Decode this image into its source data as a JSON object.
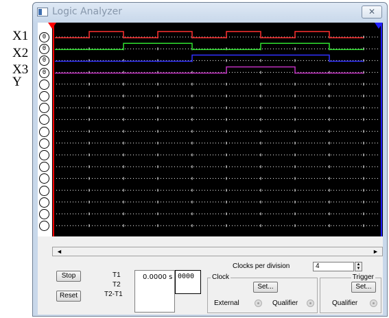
{
  "external_labels": [
    "X1",
    "X2",
    "X3",
    "Y"
  ],
  "window": {
    "title": "Logic Analyzer",
    "close_glyph": "✕"
  },
  "pins": [
    "0",
    "0",
    "0",
    "0",
    "",
    "",
    "",
    "",
    "",
    "",
    "",
    "",
    "",
    "",
    "",
    "",
    ""
  ],
  "cursors": {
    "t1": "1",
    "t2": "2",
    "t1_color": "#ff0000",
    "t2_color": "#2020ff"
  },
  "traces": [
    {
      "name": "X1",
      "color": "#ff3030",
      "levels": [
        0,
        1,
        0,
        1,
        0,
        1,
        0,
        1,
        0
      ]
    },
    {
      "name": "X2",
      "color": "#30e030",
      "levels": [
        0,
        0,
        1,
        1,
        0,
        0,
        1,
        1,
        0
      ]
    },
    {
      "name": "X3",
      "color": "#3030ff",
      "levels": [
        0,
        0,
        0,
        0,
        1,
        1,
        1,
        1,
        0
      ]
    },
    {
      "name": "Y",
      "color": "#c030c0",
      "levels": [
        0,
        0,
        0,
        0,
        0,
        1,
        1,
        0,
        0
      ]
    }
  ],
  "scrollbar": {
    "left_arrow": "◄",
    "right_arrow": "►"
  },
  "controls": {
    "stop": "Stop",
    "reset": "Reset",
    "t1_label": "T1",
    "t2_label": "T2",
    "t2t1_label": "T2-T1",
    "t1_value": "0.0000  s",
    "counter_value": "0000",
    "clocks_per_division_label": "Clocks per division",
    "clocks_per_division": "4",
    "clock_group": "Clock",
    "trigger_group": "Trigger",
    "clock_set": "Set...",
    "trigger_set": "Set...",
    "external": "External",
    "qualifier_clock": "Qualifier",
    "qualifier_trigger": "Qualifier"
  }
}
